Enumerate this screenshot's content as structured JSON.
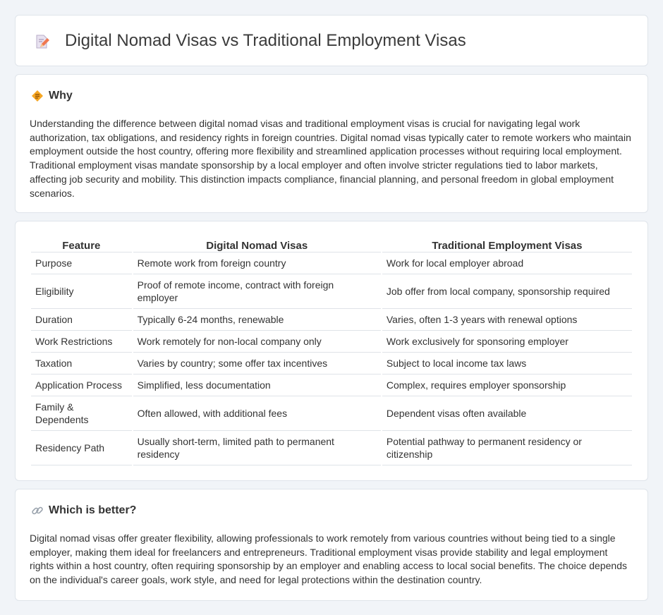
{
  "header": {
    "title": "Digital Nomad Visas vs Traditional Employment Visas",
    "icon": "document-pencil-icon"
  },
  "why": {
    "heading": "Why",
    "icon": "diamond-sign-icon",
    "text": "Understanding the difference between digital nomad visas and traditional employment visas is crucial for navigating legal work authorization, tax obligations, and residency rights in foreign countries. Digital nomad visas typically cater to remote workers who maintain employment outside the host country, offering more flexibility and streamlined application processes without requiring local employment. Traditional employment visas mandate sponsorship by a local employer and often involve stricter regulations tied to labor markets, affecting job security and mobility. This distinction impacts compliance, financial planning, and personal freedom in global employment scenarios."
  },
  "table": {
    "headers": [
      "Feature",
      "Digital Nomad Visas",
      "Traditional Employment Visas"
    ],
    "rows": [
      [
        "Purpose",
        "Remote work from foreign country",
        "Work for local employer abroad"
      ],
      [
        "Eligibility",
        "Proof of remote income, contract with foreign employer",
        "Job offer from local company, sponsorship required"
      ],
      [
        "Duration",
        "Typically 6-24 months, renewable",
        "Varies, often 1-3 years with renewal options"
      ],
      [
        "Work Restrictions",
        "Work remotely for non-local company only",
        "Work exclusively for sponsoring employer"
      ],
      [
        "Taxation",
        "Varies by country; some offer tax incentives",
        "Subject to local income tax laws"
      ],
      [
        "Application Process",
        "Simplified, less documentation",
        "Complex, requires employer sponsorship"
      ],
      [
        "Family & Dependents",
        "Often allowed, with additional fees",
        "Dependent visas often available"
      ],
      [
        "Residency Path",
        "Usually short-term, limited path to permanent residency",
        "Potential pathway to permanent residency or citizenship"
      ]
    ]
  },
  "better": {
    "heading": "Which is better?",
    "icon": "link-icon",
    "text": "Digital nomad visas offer greater flexibility, allowing professionals to work remotely from various countries without being tied to a single employer, making them ideal for freelancers and entrepreneurs. Traditional employment visas provide stability and legal employment rights within a host country, often requiring sponsorship by an employer and enabling access to local social benefits. The choice depends on the individual's career goals, work style, and need for legal protections within the destination country."
  },
  "colors": {
    "background": "#f1f4f8",
    "card": "#ffffff",
    "border": "#dfe4ea",
    "accent": "#f0a030"
  }
}
